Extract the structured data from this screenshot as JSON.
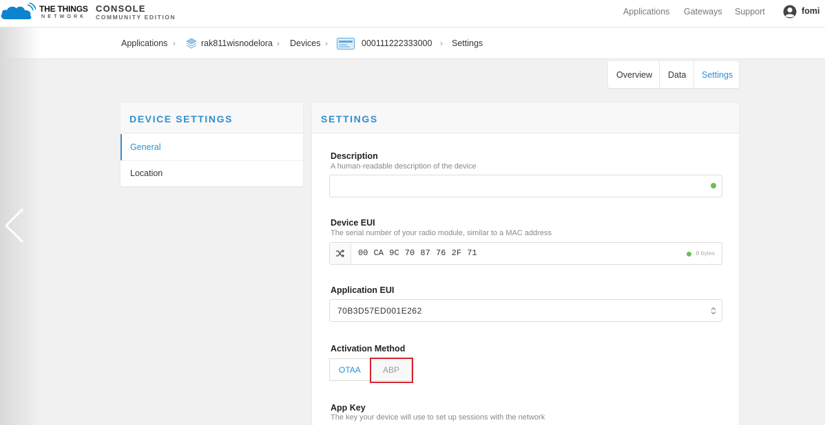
{
  "header": {
    "brand_line1": "THE THINGS",
    "brand_line2": "NETWORK",
    "console_line1": "CONSOLE",
    "console_line2": "COMMUNITY EDITION",
    "nav": [
      "Applications",
      "Gateways",
      "Support"
    ],
    "username": "fomi"
  },
  "breadcrumb": {
    "applications": "Applications",
    "app_id": "rak811wisnodelora",
    "devices": "Devices",
    "device_id": "000111222333000",
    "settings": "Settings"
  },
  "tabs": {
    "overview": "Overview",
    "data": "Data",
    "settings": "Settings"
  },
  "sidebar": {
    "title": "DEVICE SETTINGS",
    "items": [
      {
        "label": "General",
        "active": true
      },
      {
        "label": "Location",
        "active": false
      }
    ]
  },
  "settings": {
    "title": "SETTINGS",
    "description": {
      "label": "Description",
      "help": "A human-readable description of the device",
      "value": ""
    },
    "device_eui": {
      "label": "Device EUI",
      "help": "The serial number of your radio module, similar to a MAC address",
      "value": "00 CA 9C 70 87 76 2F 71",
      "bytes": "8 bytes"
    },
    "application_eui": {
      "label": "Application EUI",
      "value": "70B3D57ED001E262"
    },
    "activation": {
      "label": "Activation Method",
      "options": [
        "OTAA",
        "ABP"
      ],
      "selected": "OTAA"
    },
    "app_key": {
      "label": "App Key",
      "help": "The key your device will use to set up sessions with the network"
    }
  },
  "colors": {
    "accent": "#2e8fd1",
    "ok": "#6cc04a",
    "highlight": "#d9232f"
  }
}
